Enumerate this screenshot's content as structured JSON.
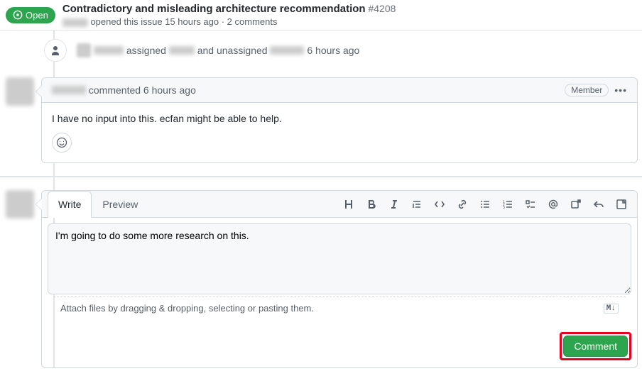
{
  "header": {
    "status": "Open",
    "title": "Contradictory and misleading architecture recommendation",
    "issue_number": "#4208",
    "subhead_prefix": "opened this issue 15 hours ago · 2 comments"
  },
  "timeline": {
    "assigned_text": "assigned",
    "and_unassigned_text": "and unassigned",
    "time_ago": "6 hours ago"
  },
  "comment": {
    "commented_text": "commented 6 hours ago",
    "member_badge": "Member",
    "body": "I have no input into this. ecfan might be able to help."
  },
  "compose": {
    "tab_write": "Write",
    "tab_preview": "Preview",
    "textarea_value": "I'm going to do some more research on this.",
    "attach_hint": "Attach files by dragging & dropping, selecting or pasting them.",
    "md_icon": "M↓",
    "submit_label": "Comment"
  }
}
